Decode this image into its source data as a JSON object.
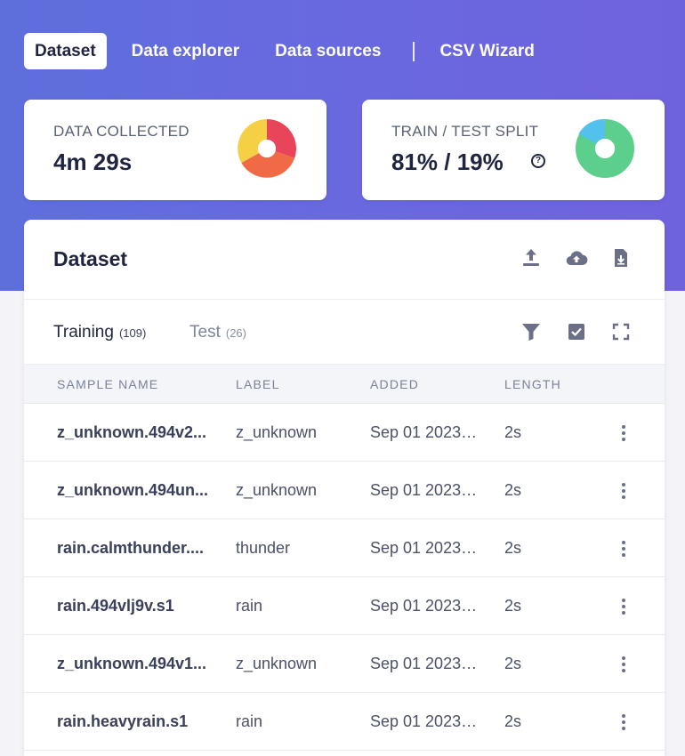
{
  "nav": {
    "tabs": [
      {
        "label": "Dataset",
        "active": true
      },
      {
        "label": "Data explorer",
        "active": false
      },
      {
        "label": "Data sources",
        "active": false
      },
      {
        "label": "CSV Wizard",
        "active": false
      }
    ]
  },
  "stats": {
    "collected": {
      "label": "DATA COLLECTED",
      "value": "4m 29s",
      "chart_colors": [
        "#e8445a",
        "#ef6a45",
        "#f5cf44"
      ]
    },
    "split": {
      "label": "TRAIN / TEST SPLIT",
      "value": "81% / 19%",
      "train_percent": 81,
      "test_percent": 19,
      "chart_colors": [
        "#5ccf8c",
        "#52c1ec"
      ]
    }
  },
  "dataset": {
    "title": "Dataset",
    "header_icons": [
      "upload-icon",
      "cloud-upload-icon",
      "download-file-icon"
    ],
    "tabs": [
      {
        "label": "Training",
        "count": "(109)",
        "active": true
      },
      {
        "label": "Test",
        "count": "(26)",
        "active": false
      }
    ],
    "tool_icons": [
      "filter-icon",
      "checkbox-icon",
      "fullscreen-icon"
    ],
    "columns": [
      "SAMPLE NAME",
      "LABEL",
      "ADDED",
      "LENGTH"
    ],
    "rows": [
      {
        "name": "z_unknown.494v2...",
        "label": "z_unknown",
        "added": "Sep 01 2023, ...",
        "length": "2s"
      },
      {
        "name": "z_unknown.494un...",
        "label": "z_unknown",
        "added": "Sep 01 2023, ...",
        "length": "2s"
      },
      {
        "name": "rain.calmthunder....",
        "label": "thunder",
        "added": "Sep 01 2023, ...",
        "length": "2s"
      },
      {
        "name": "rain.494vlj9v.s1",
        "label": "rain",
        "added": "Sep 01 2023, ...",
        "length": "2s"
      },
      {
        "name": "z_unknown.494v1...",
        "label": "z_unknown",
        "added": "Sep 01 2023, ...",
        "length": "2s"
      },
      {
        "name": "rain.heavyrain.s1",
        "label": "rain",
        "added": "Sep 01 2023, ...",
        "length": "2s"
      }
    ]
  }
}
